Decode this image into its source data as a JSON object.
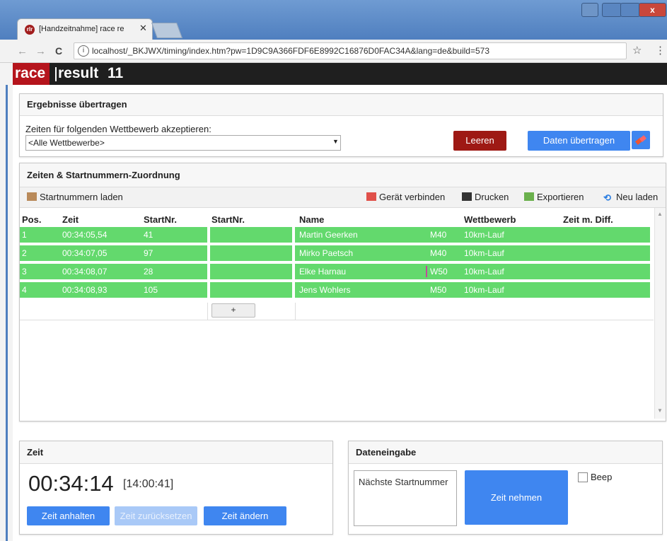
{
  "browser": {
    "tab_favicon_text": "rlr",
    "tab_title": "[Handzeitnahme] race re",
    "tab_close": "✕",
    "url": "localhost/_BKJWX/timing/index.htm?pw=1D9C9A366FDF6E8992C16876D0FAC34A&lang=de&build=573",
    "nav_back": "←",
    "nav_forward": "→",
    "nav_reload": "C",
    "info_icon": "i",
    "star": "☆",
    "menu": "⋮",
    "close_glyph": "x"
  },
  "brand": {
    "race": "race",
    "result": "result",
    "version": "11"
  },
  "transfer": {
    "title": "Ergebnisse übertragen",
    "label": "Zeiten für folgenden Wettbewerb akzeptieren:",
    "selected": "<Alle Wettbewerbe>",
    "clear_label": "Leeren",
    "transfer_label": "Daten übertragen"
  },
  "assignment": {
    "title": "Zeiten & Startnummern-Zuordnung",
    "toolbar": {
      "load_bibs": "Startnummern laden",
      "connect_device": "Gerät verbinden",
      "print": "Drucken",
      "export": "Exportieren",
      "reload": "Neu laden"
    },
    "columns": [
      "Pos.",
      "Zeit",
      "StartNr.",
      "StartNr.",
      "Name",
      "Wettbewerb",
      "Zeit m. Diff."
    ],
    "rows": [
      {
        "pos": "1",
        "time": "00:34:05,54",
        "bib": "41",
        "name": "Martin Geerken",
        "group": "M40",
        "contest": "10km-Lauf"
      },
      {
        "pos": "2",
        "time": "00:34:07,05",
        "bib": "97",
        "name": "Mirko Paetsch",
        "group": "M40",
        "contest": "10km-Lauf"
      },
      {
        "pos": "3",
        "time": "00:34:08,07",
        "bib": "28",
        "name": "Elke Harnau",
        "group": "W50",
        "contest": "10km-Lauf"
      },
      {
        "pos": "4",
        "time": "00:34:08,93",
        "bib": "105",
        "name": "Jens Wohlers",
        "group": "M50",
        "contest": "10km-Lauf"
      }
    ],
    "plus": "+"
  },
  "time_panel": {
    "title": "Zeit",
    "elapsed": "00:34:14",
    "clock": "[14:00:41]",
    "stop_label": "Zeit anhalten",
    "reset_label": "Zeit zurücksetzen",
    "change_label": "Zeit ändern"
  },
  "entry_panel": {
    "title": "Dateneingabe",
    "next_bib_placeholder": "Nächste Startnummer",
    "take_time_label": "Zeit nehmen",
    "beep_label": "Beep"
  },
  "colors": {
    "brand_red": "#b5141c",
    "button_blue": "#3f86f0",
    "button_red": "#9e1914",
    "row_green": "#63d96d"
  }
}
